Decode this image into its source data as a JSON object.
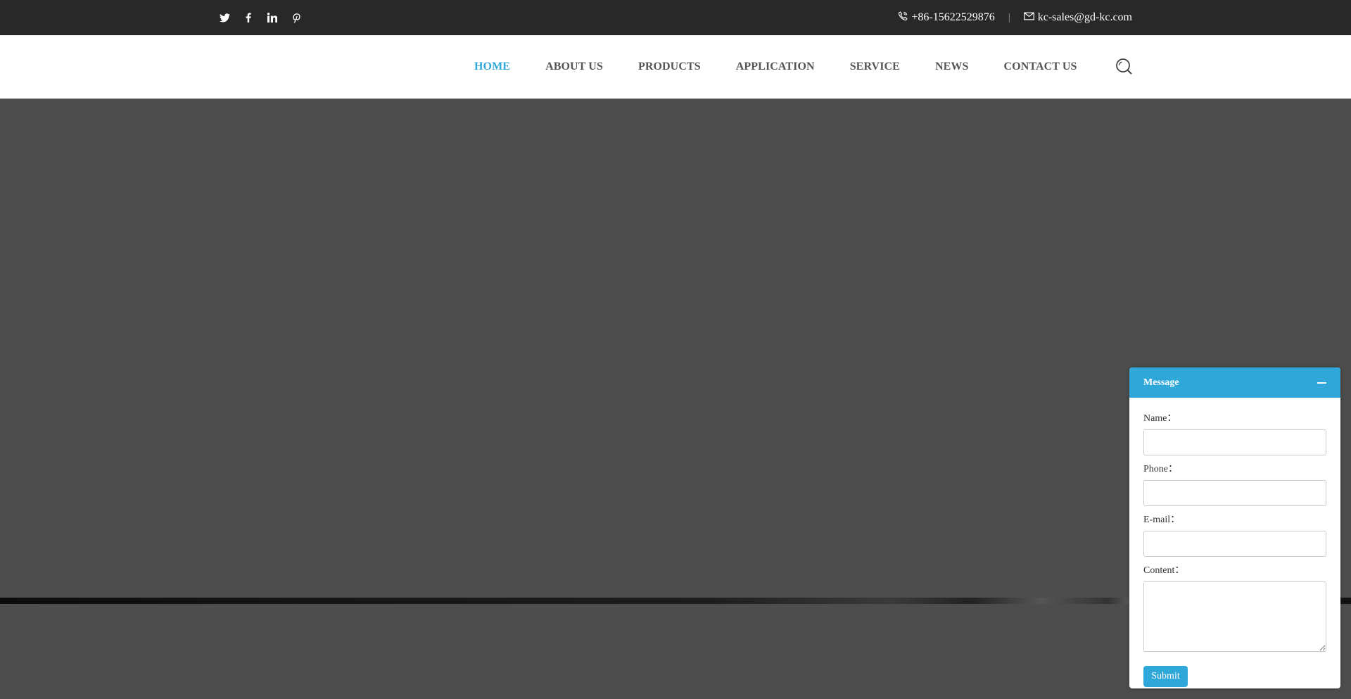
{
  "topbar": {
    "social_icons": [
      "twitter-icon",
      "facebook-icon",
      "linkedin-icon",
      "pinterest-icon"
    ],
    "phone": "+86-15622529876",
    "separator": "|",
    "email": "kc-sales@gd-kc.com"
  },
  "nav": {
    "items": [
      "HOME",
      "ABOUT US",
      "PRODUCTS",
      "APPLICATION",
      "SERVICE",
      "NEWS",
      "CONTACT US"
    ],
    "active_index": 0,
    "active_color": "#2fa7d9"
  },
  "message_form": {
    "title": "Message",
    "name_label": "Name：",
    "phone_label": "Phone：",
    "email_label": "E-mail：",
    "content_label": "Content：",
    "submit_label": "Submit",
    "accent_color": "#2fa7d9"
  },
  "colors": {
    "topbar_bg": "#282828",
    "hero_bg": "#4d4d4d"
  }
}
